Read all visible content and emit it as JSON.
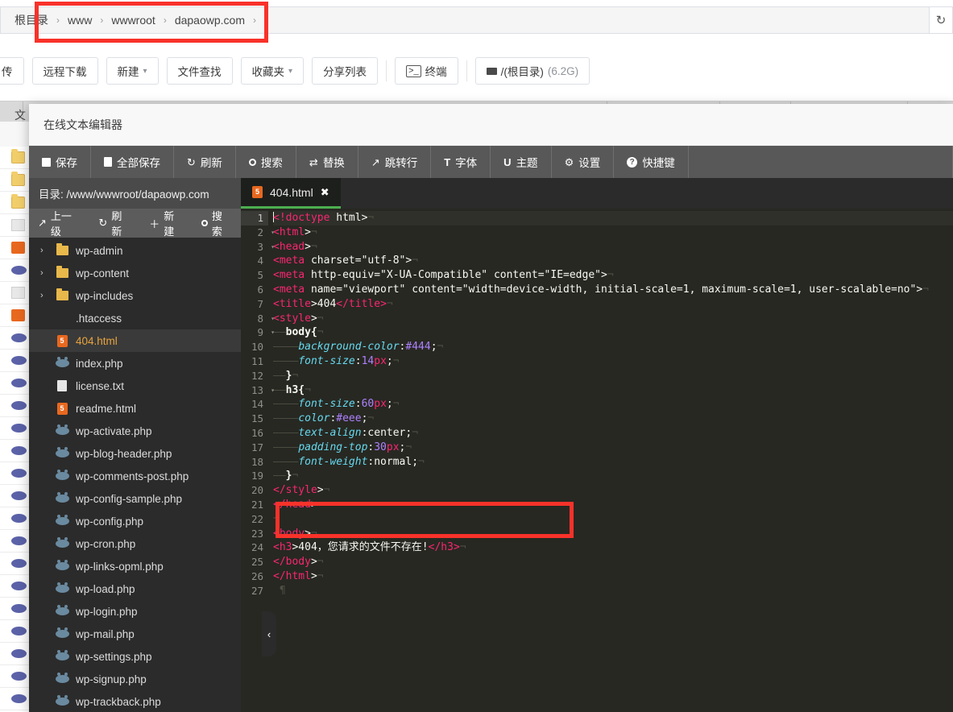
{
  "file_manager": {
    "breadcrumb": {
      "root_label": "根目录",
      "items": [
        "www",
        "wwwroot",
        "dapaowp.com"
      ],
      "separator": "›",
      "refresh_icon": "↻"
    },
    "toolbar": {
      "buttons": [
        {
          "label": "远程下载",
          "caret": false
        },
        {
          "label": "新建",
          "caret": true
        },
        {
          "label": "文件查找",
          "caret": false
        },
        {
          "label": "收藏夹",
          "caret": true
        },
        {
          "label": "分享列表",
          "caret": false
        }
      ],
      "terminal": {
        "label": "终端",
        "icon": "terminal-icon"
      },
      "disk": {
        "label": "/(根目录)",
        "size": "(6.2G)",
        "icon": "disk-icon"
      }
    }
  },
  "editor_modal": {
    "title": "在线文本编辑器",
    "toolbar": [
      {
        "label": "保存",
        "icon": "save-icon",
        "glyph": "💾"
      },
      {
        "label": "全部保存",
        "icon": "save-all-icon",
        "glyph": "📑"
      },
      {
        "label": "刷新",
        "icon": "refresh-icon",
        "glyph": "↻"
      },
      {
        "label": "搜索",
        "icon": "search-icon",
        "glyph": "🔍"
      },
      {
        "label": "替换",
        "icon": "replace-icon",
        "glyph": "⇄"
      },
      {
        "label": "跳转行",
        "icon": "goto-line-icon",
        "glyph": "↗"
      },
      {
        "label": "字体",
        "icon": "font-icon",
        "glyph": "T"
      },
      {
        "label": "主题",
        "icon": "theme-icon",
        "glyph": "U"
      },
      {
        "label": "设置",
        "icon": "settings-gear-icon",
        "glyph": "⚙"
      },
      {
        "label": "快捷键",
        "icon": "help-question-icon",
        "glyph": "?"
      }
    ],
    "directory_label": "目录: /www/wwwroot/dapaowp.com",
    "tree_toolbar": [
      {
        "label": "上一级",
        "icon": "up-level-icon",
        "glyph": "↗"
      },
      {
        "label": "刷新",
        "icon": "refresh-icon",
        "glyph": "↻"
      },
      {
        "label": "新建",
        "icon": "plus-icon",
        "glyph": "＋"
      },
      {
        "label": "搜索",
        "icon": "search-icon",
        "glyph": "🔍"
      }
    ],
    "collapse_handle_icon": "‹",
    "tree": [
      {
        "name": "wp-admin",
        "type": "folder",
        "expandable": true,
        "selected": false
      },
      {
        "name": "wp-content",
        "type": "folder",
        "expandable": true,
        "selected": false
      },
      {
        "name": "wp-includes",
        "type": "folder",
        "expandable": true,
        "selected": false
      },
      {
        "name": ".htaccess",
        "type": "none",
        "expandable": false,
        "selected": false
      },
      {
        "name": "404.html",
        "type": "html",
        "expandable": false,
        "selected": true
      },
      {
        "name": "index.php",
        "type": "php",
        "expandable": false,
        "selected": false
      },
      {
        "name": "license.txt",
        "type": "txt",
        "expandable": false,
        "selected": false
      },
      {
        "name": "readme.html",
        "type": "html",
        "expandable": false,
        "selected": false
      },
      {
        "name": "wp-activate.php",
        "type": "php",
        "expandable": false,
        "selected": false
      },
      {
        "name": "wp-blog-header.php",
        "type": "php",
        "expandable": false,
        "selected": false
      },
      {
        "name": "wp-comments-post.php",
        "type": "php",
        "expandable": false,
        "selected": false
      },
      {
        "name": "wp-config-sample.php",
        "type": "php",
        "expandable": false,
        "selected": false
      },
      {
        "name": "wp-config.php",
        "type": "php",
        "expandable": false,
        "selected": false
      },
      {
        "name": "wp-cron.php",
        "type": "php",
        "expandable": false,
        "selected": false
      },
      {
        "name": "wp-links-opml.php",
        "type": "php",
        "expandable": false,
        "selected": false
      },
      {
        "name": "wp-load.php",
        "type": "php",
        "expandable": false,
        "selected": false
      },
      {
        "name": "wp-login.php",
        "type": "php",
        "expandable": false,
        "selected": false
      },
      {
        "name": "wp-mail.php",
        "type": "php",
        "expandable": false,
        "selected": false
      },
      {
        "name": "wp-settings.php",
        "type": "php",
        "expandable": false,
        "selected": false
      },
      {
        "name": "wp-signup.php",
        "type": "php",
        "expandable": false,
        "selected": false
      },
      {
        "name": "wp-trackback.php",
        "type": "php",
        "expandable": false,
        "selected": false
      }
    ],
    "tabs": [
      {
        "label": "404.html",
        "icon": "html5-icon",
        "active": true,
        "close_icon": "✖"
      }
    ],
    "code": {
      "language": "html",
      "active_line": 1,
      "total_lines": 27,
      "fold_markers": [
        2,
        3,
        8,
        9,
        13
      ],
      "lines": [
        "<!doctype html>",
        "<html>",
        "<head>",
        "<meta charset=\"utf-8\">",
        "<meta http-equiv=\"X-UA-Compatible\" content=\"IE=edge\">",
        "<meta name=\"viewport\" content=\"width=device-width, initial-scale=1, maximum-scale=1, user-scalable=no\">",
        "<title>404</title>",
        "<style>",
        "    body{",
        "        background-color:#444;",
        "        font-size:14px;",
        "    }",
        "    h3{",
        "        font-size:60px;",
        "        color:#eee;",
        "        text-align:center;",
        "        padding-top:30px;",
        "        font-weight:normal;",
        "    }",
        "</style>",
        "</head>",
        "",
        "<body>",
        "<h3>404，您请求的文件不存在!</h3>",
        "</body>",
        "</html>",
        ""
      ]
    }
  },
  "annotations": {
    "highlight_color": "#f8322a",
    "boxes": [
      {
        "name": "breadcrumb-path-highlight",
        "target": "www > wwwroot > dapaowp.com"
      },
      {
        "name": "body-h3-code-highlight",
        "target": "<body> / <h3>404，您请求的文件不存在!</h3>"
      }
    ]
  }
}
